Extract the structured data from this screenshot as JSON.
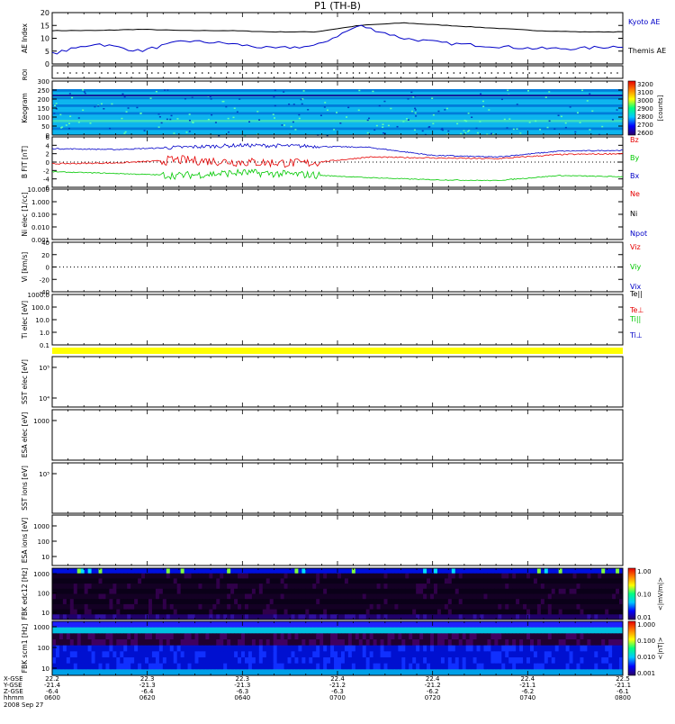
{
  "title": "P1 (TH-B)",
  "colors": {
    "black": "#000000",
    "blue": "#0000c8",
    "red": "#e60000",
    "green": "#00c800",
    "yellow": "#ffff00",
    "dark_purple": "#1a0028"
  },
  "x_ticks": {
    "labels_x": [
      "22.2",
      "22.3",
      "22.3",
      "22.4",
      "22.4",
      "22.4",
      "22.5"
    ],
    "labels_y": [
      "-21.4",
      "-21.3",
      "-21.3",
      "-21.2",
      "-21.2",
      "-21.1",
      "-21.1"
    ],
    "labels_z": [
      "-6.4",
      "-6.4",
      "-6.3",
      "-6.3",
      "-6.2",
      "-6.2",
      "-6.1"
    ],
    "labels_hhmm": [
      "0600",
      "0620",
      "0640",
      "0700",
      "0720",
      "0740",
      "0800"
    ],
    "row_labels": [
      "X-GSE",
      "Y-GSE",
      "Z-GSE",
      "hhmm"
    ],
    "date": "2008 Sep 27"
  },
  "panels": {
    "ae": {
      "ylabel": "AE Index",
      "yticks": [
        "20",
        "15",
        "10",
        "5",
        "0"
      ],
      "legend": [
        "Kyoto AE",
        "Themis AE"
      ]
    },
    "roi": {
      "ylabel": "ROI"
    },
    "keogram": {
      "ylabel": "Keogram",
      "yticks": [
        "300",
        "250",
        "200",
        "150",
        "100",
        "50",
        "0"
      ],
      "cbar_ticks": [
        "3200",
        "3100",
        "3000",
        "2900",
        "2800",
        "2700",
        "2600"
      ],
      "cbar_label": "[counts]"
    },
    "bfield": {
      "ylabel": "B FIT [nT]",
      "yticks": [
        "6",
        "4",
        "2",
        "0",
        "-2",
        "-4",
        "-6"
      ],
      "legend": [
        "Bz",
        "By",
        "Bx"
      ]
    },
    "density": {
      "ylabel": "Ni elec [1/cc]",
      "yticks": [
        "10.000",
        "1.000",
        "0.100",
        "0.010",
        "0.001"
      ],
      "legend": [
        "Ne",
        "Ni",
        "Npot"
      ]
    },
    "velocity": {
      "ylabel": "Vi [km/s]",
      "yticks": [
        "40",
        "20",
        "0",
        "-20",
        "-40"
      ],
      "legend": [
        "Viz",
        "Viy",
        "Vix"
      ]
    },
    "temperature": {
      "ylabel": "Ti elec [eV]",
      "yticks": [
        "1000.0",
        "100.0",
        "10.0",
        "1.0",
        "0.1"
      ],
      "legend": [
        "Te||",
        "Te⊥",
        "Ti||",
        "Ti⊥"
      ]
    },
    "sst_e": {
      "ylabel": "SST elec [eV]",
      "yticks": [
        "10⁵",
        "10⁴"
      ]
    },
    "esa_e": {
      "ylabel": "ESA elec [eV]",
      "yticks": [
        "1000"
      ]
    },
    "sst_i": {
      "ylabel": "SST ions [eV]",
      "yticks": [
        "10⁵"
      ]
    },
    "esa_i": {
      "ylabel": "ESA ions [eV]",
      "yticks": [
        "1000",
        "100",
        "10"
      ]
    },
    "fbk_e": {
      "ylabel": "FBK edc12 [Hz]",
      "yticks": [
        "1000",
        "100",
        "10"
      ],
      "cbar_ticks": [
        "1.00",
        "0.10",
        "0.01"
      ],
      "cbar_label": "<|mV/m|>"
    },
    "fbk_b": {
      "ylabel": "FBK scm1 [Hz]",
      "yticks": [
        "1000",
        "100",
        "10"
      ],
      "cbar_ticks": [
        "1.000",
        "0.100",
        "0.010",
        "0.001"
      ],
      "cbar_label": "<|nT|>"
    }
  },
  "chart_data": [
    {
      "type": "line",
      "name": "AE Index",
      "ylabel": "AE Index",
      "ylim": [
        0,
        20
      ],
      "x": [
        "0600",
        "0610",
        "0620",
        "0630",
        "0640",
        "0650",
        "0700",
        "0705",
        "0710",
        "0720",
        "0730",
        "0740",
        "0750",
        "0800"
      ],
      "series": [
        {
          "name": "Kyoto AE",
          "values": [
            13,
            13,
            13.5,
            13,
            13,
            12.5,
            12.5,
            15,
            16,
            15,
            14,
            13,
            12.5,
            12.5
          ]
        },
        {
          "name": "Themis AE",
          "values": [
            4,
            8,
            5,
            9,
            8,
            6,
            7,
            15,
            10,
            8,
            7,
            6,
            6,
            7
          ]
        }
      ]
    },
    {
      "type": "heatmap",
      "name": "Keogram",
      "ylabel": "Keogram",
      "ylim": [
        0,
        300
      ],
      "colorbar": {
        "range": [
          2600,
          3200
        ],
        "label": "[counts]"
      }
    },
    {
      "type": "line",
      "name": "B FIT",
      "ylabel": "B FIT [nT]",
      "ylim": [
        -6,
        6
      ],
      "x": [
        "0600",
        "0620",
        "0632",
        "0640",
        "0650",
        "0700",
        "0720",
        "0740",
        "0748",
        "0800"
      ],
      "series": [
        {
          "name": "Bz",
          "values": [
            3.2,
            3,
            3.5,
            4,
            3.8,
            3.5,
            1.6,
            1.2,
            2.6,
            2.8
          ]
        },
        {
          "name": "By",
          "values": [
            -0.4,
            -0.2,
            0.5,
            0,
            -0.3,
            1.2,
            1.0,
            0.8,
            1.8,
            2.0
          ]
        },
        {
          "name": "Bx",
          "values": [
            -2.3,
            -2.7,
            -3.2,
            -2.5,
            -3.0,
            -3.7,
            -4.2,
            -4.4,
            -3.2,
            -3.5
          ]
        }
      ]
    },
    {
      "type": "heatmap",
      "name": "FBK edc12",
      "ylabel": "FBK edc12 [Hz]",
      "colorbar": {
        "range": [
          0.01,
          1.0
        ],
        "label": "<|mV/m|>"
      }
    },
    {
      "type": "heatmap",
      "name": "FBK scm1",
      "ylabel": "FBK scm1 [Hz]",
      "colorbar": {
        "range": [
          0.001,
          1.0
        ],
        "label": "<|nT|>"
      }
    }
  ]
}
